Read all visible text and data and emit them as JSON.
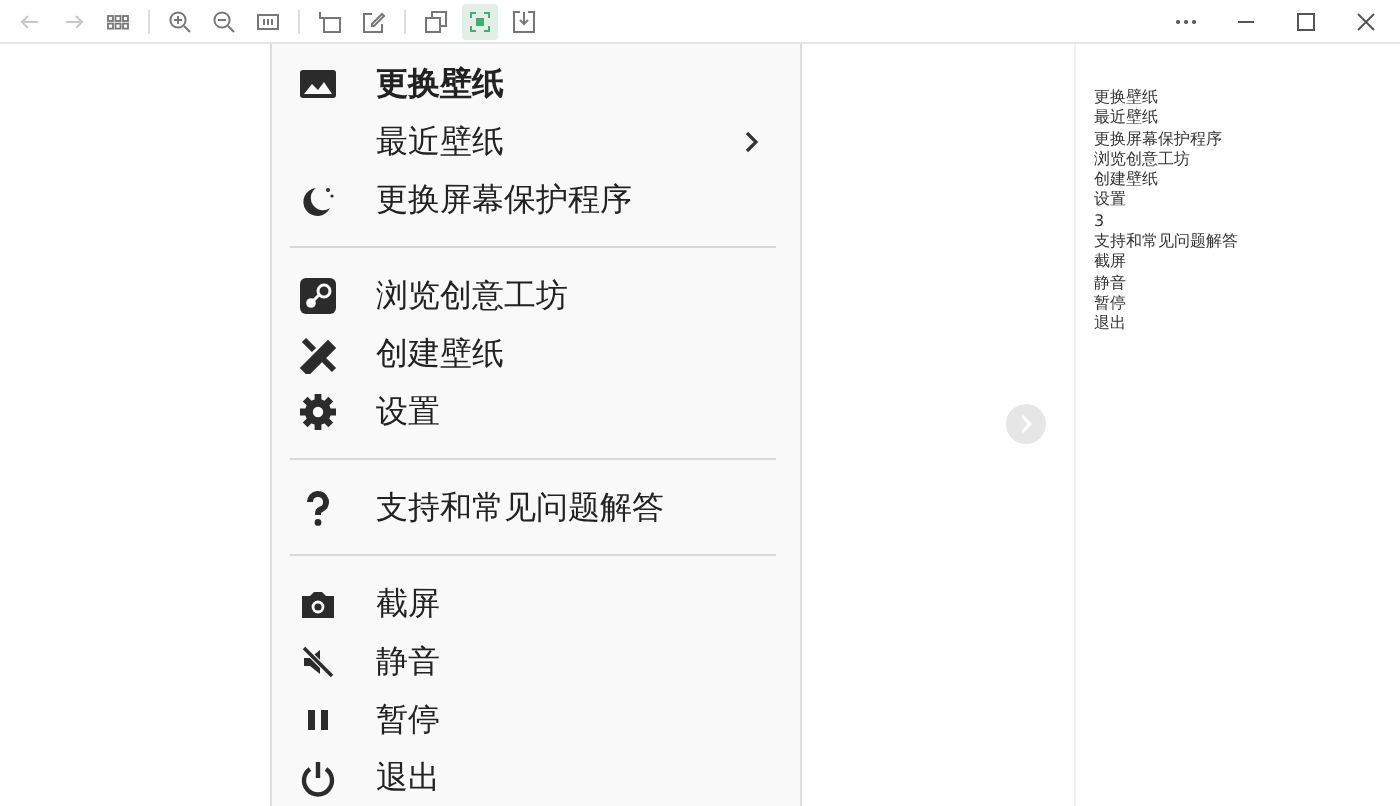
{
  "toolbar": {
    "tools": [
      {
        "kind": "back",
        "disabled": true,
        "selected": false
      },
      {
        "kind": "forward",
        "disabled": true,
        "selected": false
      },
      {
        "kind": "grid",
        "disabled": false,
        "selected": false
      },
      {
        "kind": "divider"
      },
      {
        "kind": "zoom-in",
        "disabled": false,
        "selected": false
      },
      {
        "kind": "zoom-out",
        "disabled": false,
        "selected": false
      },
      {
        "kind": "actual-size",
        "disabled": false,
        "selected": false
      },
      {
        "kind": "divider"
      },
      {
        "kind": "rotate",
        "disabled": false,
        "selected": false
      },
      {
        "kind": "edit",
        "disabled": false,
        "selected": false
      },
      {
        "kind": "divider"
      },
      {
        "kind": "copy",
        "disabled": false,
        "selected": false
      },
      {
        "kind": "fit",
        "disabled": false,
        "selected": true
      },
      {
        "kind": "save",
        "disabled": false,
        "selected": false
      }
    ]
  },
  "menu": {
    "items": [
      {
        "kind": "item",
        "label": "更换壁纸",
        "default": true,
        "submenu": false
      },
      {
        "kind": "item",
        "label": "最近壁纸",
        "default": false,
        "submenu": true
      },
      {
        "kind": "item",
        "label": "更换屏幕保护程序",
        "default": false,
        "submenu": false
      },
      {
        "kind": "separator"
      },
      {
        "kind": "item",
        "label": "浏览创意工坊",
        "default": false,
        "submenu": false
      },
      {
        "kind": "item",
        "label": "创建壁纸",
        "default": false,
        "submenu": false
      },
      {
        "kind": "item",
        "label": "设置",
        "default": false,
        "submenu": false
      },
      {
        "kind": "separator"
      },
      {
        "kind": "item",
        "label": "支持和常见问题解答",
        "default": false,
        "submenu": false
      },
      {
        "kind": "separator"
      },
      {
        "kind": "item",
        "label": "截屏",
        "default": false,
        "submenu": false
      },
      {
        "kind": "item",
        "label": "静音",
        "default": false,
        "submenu": false
      },
      {
        "kind": "item",
        "label": "暂停",
        "default": false,
        "submenu": false
      },
      {
        "kind": "item",
        "label": "退出",
        "default": false,
        "submenu": false
      }
    ]
  },
  "side_text": [
    "更换壁纸",
    "最近壁纸",
    "更换屏幕保护程序",
    "浏览创意工坊",
    "创建壁纸",
    "设置",
    "3",
    "支持和常见问题解答",
    "截屏",
    "静音",
    "暂停",
    "退出"
  ]
}
